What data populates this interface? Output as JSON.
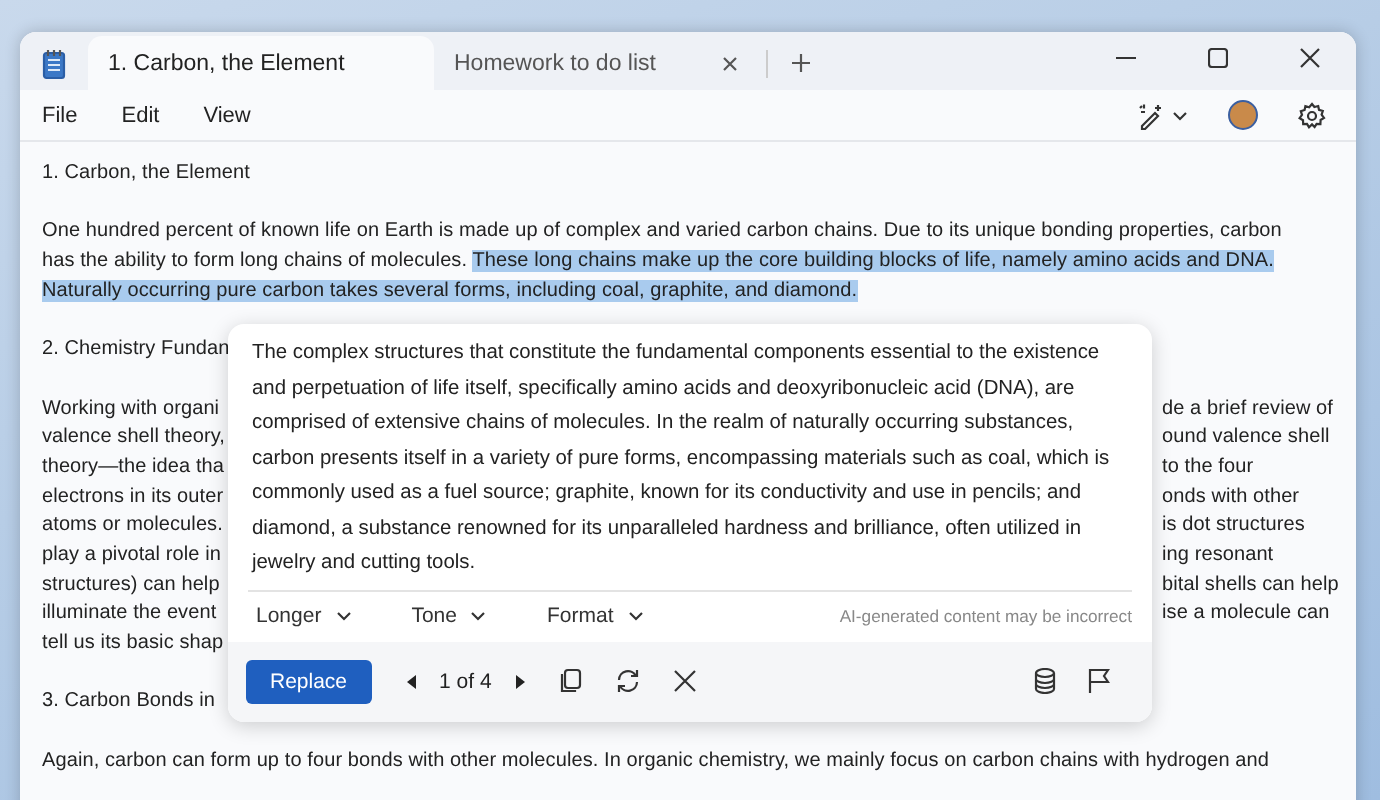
{
  "tabs": [
    {
      "label": "1. Carbon, the Element",
      "selected": true,
      "closable": false
    },
    {
      "label": "Homework to do list",
      "selected": false,
      "closable": true
    }
  ],
  "menu": [
    "File",
    "Edit",
    "View"
  ],
  "document": {
    "lines": [
      {
        "kind": "full",
        "segments": [
          {
            "text": "1. Carbon, the Element",
            "highlighted": false
          }
        ]
      },
      {
        "kind": "blank"
      },
      {
        "kind": "full",
        "segments": [
          {
            "text": "One hundred percent of known life on Earth is made up of complex and varied carbon chains. Due to its unique bonding properties, carbon",
            "highlighted": false
          }
        ]
      },
      {
        "kind": "full",
        "segments": [
          {
            "text": "has the ability to form long chains of molecules. ",
            "highlighted": false
          },
          {
            "text": "These long chains make up the core building blocks of life, namely amino acids and DNA.",
            "highlighted": true
          }
        ]
      },
      {
        "kind": "full",
        "segments": [
          {
            "text": "Naturally occurring pure carbon takes several forms, including coal, graphite, and diamond.",
            "highlighted": true
          }
        ]
      },
      {
        "kind": "blank"
      },
      {
        "kind": "split",
        "left": "2. Chemistry Fundan"
      },
      {
        "kind": "blank"
      },
      {
        "kind": "split",
        "left": "Working with organi",
        "right": "de a brief review of"
      },
      {
        "kind": "split",
        "left": "valence shell theory,",
        "right": "ound valence shell"
      },
      {
        "kind": "split",
        "left": "theory—the idea tha",
        "right": "to the four"
      },
      {
        "kind": "split",
        "left": "electrons in its outer",
        "right": "onds with other"
      },
      {
        "kind": "split",
        "left": "atoms or molecules.",
        "right": "is dot structures"
      },
      {
        "kind": "split",
        "left": "play a pivotal role in",
        "right": "ing resonant"
      },
      {
        "kind": "split",
        "left": "structures) can help",
        "right": "bital shells can help"
      },
      {
        "kind": "split",
        "left": "illuminate the event",
        "right": "ise a molecule can"
      },
      {
        "kind": "split",
        "left": "tell us its basic shap"
      },
      {
        "kind": "blank"
      },
      {
        "kind": "split",
        "left": "3. Carbon Bonds in"
      },
      {
        "kind": "blank"
      },
      {
        "kind": "full",
        "segments": [
          {
            "text": "Again, carbon can form up to four bonds with other molecules. In organic chemistry, we mainly focus on carbon chains with hydrogen and",
            "highlighted": false
          }
        ]
      }
    ]
  },
  "rewrite": {
    "text": "The complex structures that constitute the fundamental components essential to the existence and perpetuation of life itself, specifically amino acids and deoxyribonucleic acid (DNA), are comprised of extensive chains of molecules. In the realm of naturally occurring substances, carbon presents itself in a variety of pure forms, encompassing materials such as coal, which is commonly used as a fuel source; graphite, known for its conductivity and use in pencils; and diamond, a substance renowned for its unparalleled hardness and brilliance, often utilized in jewelry and cutting tools.",
    "options": [
      "Longer",
      "Tone",
      "Format"
    ],
    "disclaimer": "AI-generated content may be incorrect",
    "replace": "Replace",
    "counter": "1 of 4"
  }
}
